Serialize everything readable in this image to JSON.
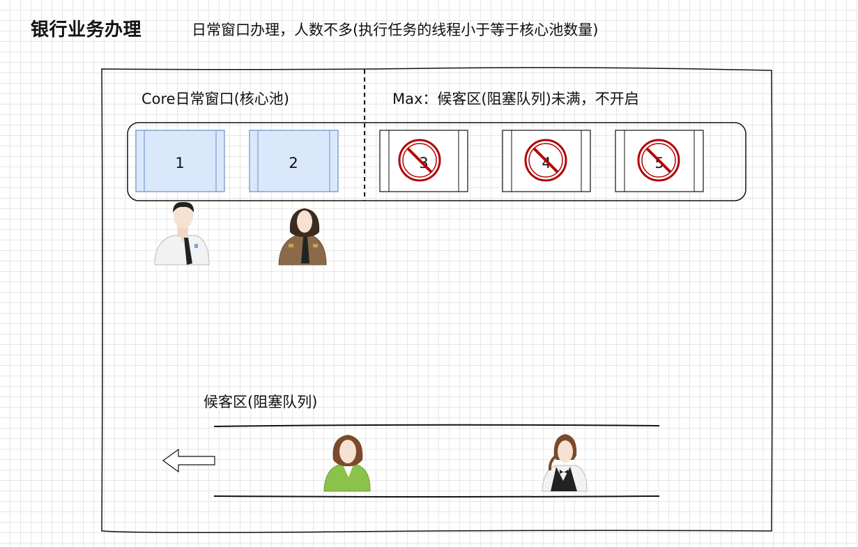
{
  "header": {
    "title": "银行业务办理",
    "subtitle": "日常窗口办理，人数不多(执行任务的线程小于等于核心池数量)"
  },
  "core_section": {
    "label": "Core日常窗口(核心池)",
    "windows": [
      "1",
      "2"
    ]
  },
  "max_section": {
    "label": "Max：候客区(阻塞队列)未满，不开启",
    "windows": [
      "3",
      "4",
      "5"
    ]
  },
  "queue": {
    "label": "候客区(阻塞队列)"
  },
  "colors": {
    "core_fill": "#dae8fc",
    "core_stroke": "#6c8ebf",
    "forbidden_red": "#b20000"
  },
  "icons": {
    "tellers": [
      "male-teller-icon",
      "female-officer-icon"
    ],
    "customers": [
      "female-customer-green-icon",
      "female-waiter-icon"
    ],
    "arrow": "left-arrow-icon",
    "forbidden": "forbidden-icon"
  }
}
